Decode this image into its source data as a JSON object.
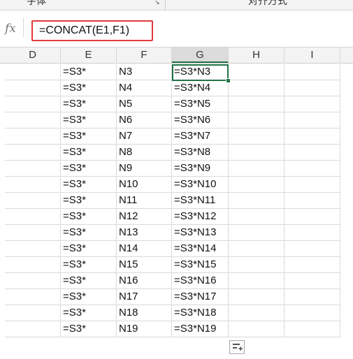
{
  "ribbon": {
    "group_font": "字体",
    "group_alignment": "对齐方式",
    "launcher_icon": "dialog-launcher-icon"
  },
  "formula_bar": {
    "fx_label": "fx",
    "formula": "=CONCAT(E1,F1)",
    "highlight_color": "#e03c3c"
  },
  "columns": [
    "D",
    "E",
    "F",
    "G",
    "H",
    "I"
  ],
  "active_column": "G",
  "active_cell": "G1",
  "accent_color": "#217346",
  "rows": [
    {
      "E": "=S3*",
      "F": "N3",
      "G": "=S3*N3"
    },
    {
      "E": "=S3*",
      "F": "N4",
      "G": "=S3*N4"
    },
    {
      "E": "=S3*",
      "F": "N5",
      "G": "=S3*N5"
    },
    {
      "E": "=S3*",
      "F": "N6",
      "G": "=S3*N6"
    },
    {
      "E": "=S3*",
      "F": "N7",
      "G": "=S3*N7"
    },
    {
      "E": "=S3*",
      "F": "N8",
      "G": "=S3*N8"
    },
    {
      "E": "=S3*",
      "F": "N9",
      "G": "=S3*N9"
    },
    {
      "E": "=S3*",
      "F": "N10",
      "G": "=S3*N10"
    },
    {
      "E": "=S3*",
      "F": "N11",
      "G": "=S3*N11"
    },
    {
      "E": "=S3*",
      "F": "N12",
      "G": "=S3*N12"
    },
    {
      "E": "=S3*",
      "F": "N13",
      "G": "=S3*N13"
    },
    {
      "E": "=S3*",
      "F": "N14",
      "G": "=S3*N14"
    },
    {
      "E": "=S3*",
      "F": "N15",
      "G": "=S3*N15"
    },
    {
      "E": "=S3*",
      "F": "N16",
      "G": "=S3*N16"
    },
    {
      "E": "=S3*",
      "F": "N17",
      "G": "=S3*N17"
    },
    {
      "E": "=S3*",
      "F": "N18",
      "G": "=S3*N18"
    },
    {
      "E": "=S3*",
      "F": "N19",
      "G": "=S3*N19"
    }
  ],
  "quick_analysis_icon": "quick-analysis-icon"
}
